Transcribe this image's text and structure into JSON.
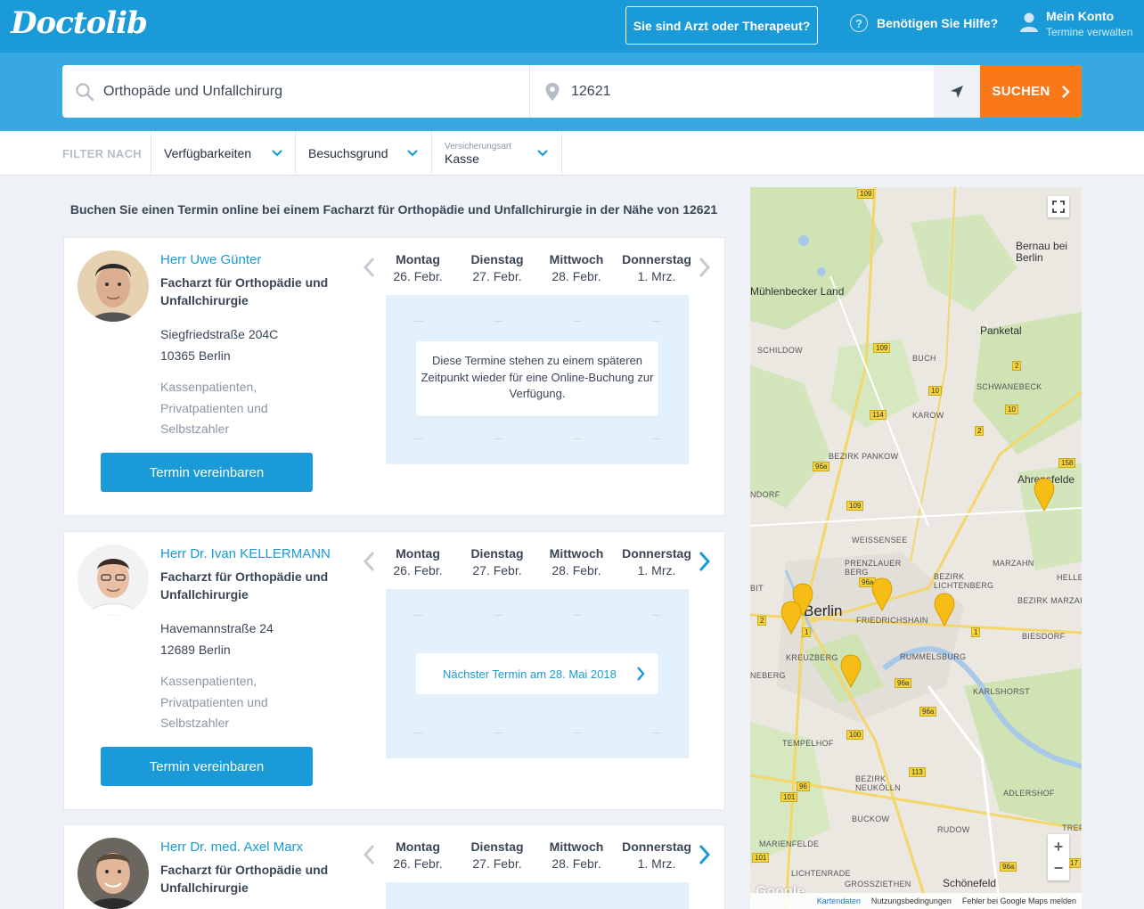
{
  "header": {
    "logo": "Doctolib",
    "pro_button": "Sie sind Arzt oder Therapeut?",
    "help_label": "Benötigen Sie Hilfe?",
    "account_title": "Mein Konto",
    "account_sub": "Termine verwalten"
  },
  "search": {
    "specialty_value": "Orthopäde und Unfallchirurg",
    "location_value": "12621",
    "search_button": "SUCHEN"
  },
  "filters": {
    "label": "FILTER NACH",
    "availability": "Verfügbarkeiten",
    "reason": "Besuchsgrund",
    "insurance_label": "Versicherungsart",
    "insurance_value": "Kasse"
  },
  "headline": "Buchen Sie einen Termin online bei einem Facharzt für Orthopädie und Unfallchirurgie in der Nähe von 12621",
  "days": [
    {
      "name": "Montag",
      "date": "26. Febr."
    },
    {
      "name": "Dienstag",
      "date": "27. Febr."
    },
    {
      "name": "Mittwoch",
      "date": "28. Febr."
    },
    {
      "name": "Donnerstag",
      "date": "1. Mrz."
    }
  ],
  "doctors": [
    {
      "name": "Herr Uwe Günter",
      "specialty": "Facharzt für Orthopädie und Unfallchirurgie",
      "street": "Siegfriedstraße 204C",
      "city": "10365 Berlin",
      "insurance": "Kassenpatienten, Privatpatienten und Selbstzahler",
      "book_label": "Termin vereinbaren",
      "notice": "Diese Termine stehen zu einem späteren Zeitpunkt wieder für eine Online-Buchung zur Verfügung."
    },
    {
      "name": "Herr Dr. Ivan KELLERMANN",
      "specialty": "Facharzt für Orthopädie und Unfallchirurgie",
      "street": "Havemannstraße 24",
      "city": "12689 Berlin",
      "insurance": "Kassenpatienten, Privatpatienten und Selbstzahler",
      "book_label": "Termin vereinbaren",
      "next_appointment": "Nächster Termin am 28. Mai 2018"
    },
    {
      "name": "Herr Dr. med. Axel Marx",
      "specialty": "Facharzt für Orthopädie und Unfallchirurgie"
    }
  ],
  "map": {
    "places": [
      "Bernau bei Berlin",
      "Mühlenbecker Land",
      "Panketal",
      "SCHILDOW",
      "BUCH",
      "SCHWANEBECK",
      "KAROW",
      "BEZIRK PANKOW",
      "Ahrensfelde",
      "WEISSENSEE",
      "PRENZLAUER BERG",
      "BEZIRK LICHTENBERG",
      "MARZAHN",
      "HELLE",
      "BEZIRK MARZAHN-HELLERSDO",
      "Berlin",
      "FRIEDRICHSHAIN",
      "BIESDORF",
      "KREUZBERG",
      "RUMMELSBURG",
      "KARLSHORST",
      "TEMPELHOF",
      "BEZIRK NEUKÖLLN",
      "ADLERSHOF",
      "BUCKOW",
      "RUDOW",
      "MARIENFELDE",
      "LICHTENRADE",
      "GROSSZIETHEN",
      "Schönefeld",
      "NDORF",
      "NEBERG",
      "BIT",
      "TREP"
    ],
    "roads": [
      "109",
      "109",
      "10",
      "10",
      "114",
      "2",
      "2",
      "96a",
      "158",
      "109",
      "96a",
      "1",
      "1",
      "2",
      "100",
      "96a",
      "96a",
      "113",
      "96",
      "101",
      "101",
      "96a",
      "17"
    ],
    "footer_data": "Kartendaten",
    "footer_terms": "Nutzungsbedingungen",
    "footer_report": "Fehler bei Google Maps melden",
    "google": "Google",
    "zoom_in": "+",
    "zoom_out": "−"
  }
}
